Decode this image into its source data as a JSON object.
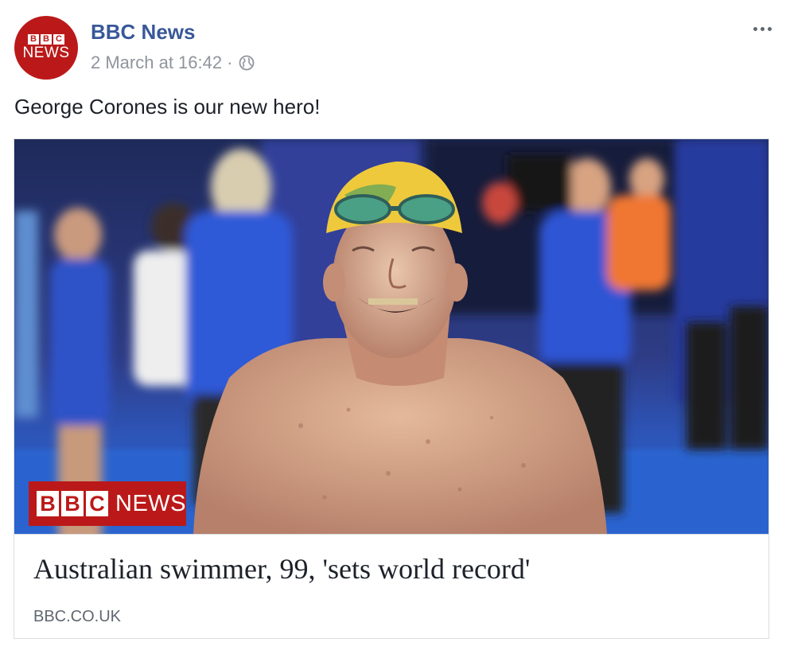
{
  "post": {
    "author": "BBC News",
    "timestamp": "2 March at 16:42",
    "separator": "·",
    "privacy_icon": "globe-icon",
    "more_icon": "ellipsis-icon",
    "text": "George Corones is our new hero!"
  },
  "avatar": {
    "letters": [
      "B",
      "B",
      "C"
    ],
    "news": "NEWS",
    "color": "#bb1919"
  },
  "link": {
    "watermark_letters": [
      "B",
      "B",
      "C"
    ],
    "watermark_news": "NEWS",
    "headline": "Australian swimmer, 99, 'sets world record'",
    "domain": "BBC.CO.UK"
  },
  "colors": {
    "author_link": "#385898",
    "meta_text": "#90949c",
    "bbc_red": "#bb1919"
  }
}
